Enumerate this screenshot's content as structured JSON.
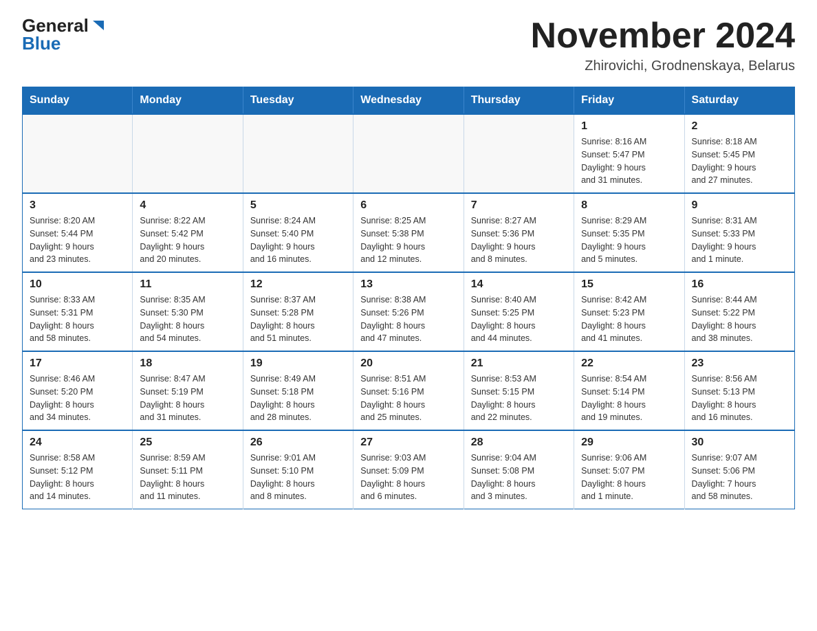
{
  "logo": {
    "general": "General",
    "blue": "Blue"
  },
  "title": "November 2024",
  "subtitle": "Zhirovichi, Grodnenskaya, Belarus",
  "days_of_week": [
    "Sunday",
    "Monday",
    "Tuesday",
    "Wednesday",
    "Thursday",
    "Friday",
    "Saturday"
  ],
  "weeks": [
    [
      {
        "day": "",
        "info": ""
      },
      {
        "day": "",
        "info": ""
      },
      {
        "day": "",
        "info": ""
      },
      {
        "day": "",
        "info": ""
      },
      {
        "day": "",
        "info": ""
      },
      {
        "day": "1",
        "info": "Sunrise: 8:16 AM\nSunset: 5:47 PM\nDaylight: 9 hours\nand 31 minutes."
      },
      {
        "day": "2",
        "info": "Sunrise: 8:18 AM\nSunset: 5:45 PM\nDaylight: 9 hours\nand 27 minutes."
      }
    ],
    [
      {
        "day": "3",
        "info": "Sunrise: 8:20 AM\nSunset: 5:44 PM\nDaylight: 9 hours\nand 23 minutes."
      },
      {
        "day": "4",
        "info": "Sunrise: 8:22 AM\nSunset: 5:42 PM\nDaylight: 9 hours\nand 20 minutes."
      },
      {
        "day": "5",
        "info": "Sunrise: 8:24 AM\nSunset: 5:40 PM\nDaylight: 9 hours\nand 16 minutes."
      },
      {
        "day": "6",
        "info": "Sunrise: 8:25 AM\nSunset: 5:38 PM\nDaylight: 9 hours\nand 12 minutes."
      },
      {
        "day": "7",
        "info": "Sunrise: 8:27 AM\nSunset: 5:36 PM\nDaylight: 9 hours\nand 8 minutes."
      },
      {
        "day": "8",
        "info": "Sunrise: 8:29 AM\nSunset: 5:35 PM\nDaylight: 9 hours\nand 5 minutes."
      },
      {
        "day": "9",
        "info": "Sunrise: 8:31 AM\nSunset: 5:33 PM\nDaylight: 9 hours\nand 1 minute."
      }
    ],
    [
      {
        "day": "10",
        "info": "Sunrise: 8:33 AM\nSunset: 5:31 PM\nDaylight: 8 hours\nand 58 minutes."
      },
      {
        "day": "11",
        "info": "Sunrise: 8:35 AM\nSunset: 5:30 PM\nDaylight: 8 hours\nand 54 minutes."
      },
      {
        "day": "12",
        "info": "Sunrise: 8:37 AM\nSunset: 5:28 PM\nDaylight: 8 hours\nand 51 minutes."
      },
      {
        "day": "13",
        "info": "Sunrise: 8:38 AM\nSunset: 5:26 PM\nDaylight: 8 hours\nand 47 minutes."
      },
      {
        "day": "14",
        "info": "Sunrise: 8:40 AM\nSunset: 5:25 PM\nDaylight: 8 hours\nand 44 minutes."
      },
      {
        "day": "15",
        "info": "Sunrise: 8:42 AM\nSunset: 5:23 PM\nDaylight: 8 hours\nand 41 minutes."
      },
      {
        "day": "16",
        "info": "Sunrise: 8:44 AM\nSunset: 5:22 PM\nDaylight: 8 hours\nand 38 minutes."
      }
    ],
    [
      {
        "day": "17",
        "info": "Sunrise: 8:46 AM\nSunset: 5:20 PM\nDaylight: 8 hours\nand 34 minutes."
      },
      {
        "day": "18",
        "info": "Sunrise: 8:47 AM\nSunset: 5:19 PM\nDaylight: 8 hours\nand 31 minutes."
      },
      {
        "day": "19",
        "info": "Sunrise: 8:49 AM\nSunset: 5:18 PM\nDaylight: 8 hours\nand 28 minutes."
      },
      {
        "day": "20",
        "info": "Sunrise: 8:51 AM\nSunset: 5:16 PM\nDaylight: 8 hours\nand 25 minutes."
      },
      {
        "day": "21",
        "info": "Sunrise: 8:53 AM\nSunset: 5:15 PM\nDaylight: 8 hours\nand 22 minutes."
      },
      {
        "day": "22",
        "info": "Sunrise: 8:54 AM\nSunset: 5:14 PM\nDaylight: 8 hours\nand 19 minutes."
      },
      {
        "day": "23",
        "info": "Sunrise: 8:56 AM\nSunset: 5:13 PM\nDaylight: 8 hours\nand 16 minutes."
      }
    ],
    [
      {
        "day": "24",
        "info": "Sunrise: 8:58 AM\nSunset: 5:12 PM\nDaylight: 8 hours\nand 14 minutes."
      },
      {
        "day": "25",
        "info": "Sunrise: 8:59 AM\nSunset: 5:11 PM\nDaylight: 8 hours\nand 11 minutes."
      },
      {
        "day": "26",
        "info": "Sunrise: 9:01 AM\nSunset: 5:10 PM\nDaylight: 8 hours\nand 8 minutes."
      },
      {
        "day": "27",
        "info": "Sunrise: 9:03 AM\nSunset: 5:09 PM\nDaylight: 8 hours\nand 6 minutes."
      },
      {
        "day": "28",
        "info": "Sunrise: 9:04 AM\nSunset: 5:08 PM\nDaylight: 8 hours\nand 3 minutes."
      },
      {
        "day": "29",
        "info": "Sunrise: 9:06 AM\nSunset: 5:07 PM\nDaylight: 8 hours\nand 1 minute."
      },
      {
        "day": "30",
        "info": "Sunrise: 9:07 AM\nSunset: 5:06 PM\nDaylight: 7 hours\nand 58 minutes."
      }
    ]
  ]
}
